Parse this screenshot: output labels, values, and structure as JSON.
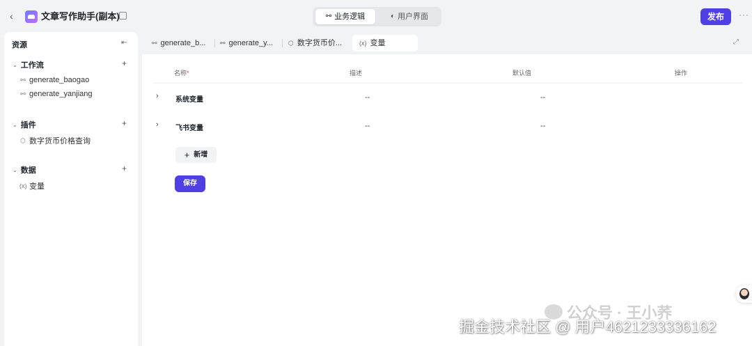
{
  "header": {
    "back_icon": "chevron-left-icon",
    "title": "文章写作助手(副本)",
    "mode_tabs": [
      {
        "label": "业务逻辑",
        "icon": "workflow-icon",
        "active": true
      },
      {
        "label": "用户界面",
        "icon": "palette-icon",
        "active": false
      }
    ],
    "publish_label": "发布",
    "more_label": "···"
  },
  "sidebar": {
    "title": "资源",
    "groups": [
      {
        "label": "工作流",
        "items": [
          {
            "label": "generate_baogao",
            "icon": "workflow-icon"
          },
          {
            "label": "generate_yanjiang",
            "icon": "workflow-icon"
          }
        ]
      },
      {
        "label": "插件",
        "items": [
          {
            "label": "数字货币价格查询",
            "icon": "plugin-icon"
          }
        ]
      },
      {
        "label": "数据",
        "items": [
          {
            "label": "变量",
            "icon": "variable-icon"
          }
        ]
      }
    ]
  },
  "tabs": [
    {
      "label": "generate_b...",
      "icon": "workflow-icon",
      "active": false
    },
    {
      "label": "generate_y...",
      "icon": "workflow-icon",
      "active": false
    },
    {
      "label": "数字货币价...",
      "icon": "plugin-icon",
      "active": false
    },
    {
      "label": "变量",
      "icon": "variable-icon",
      "active": true
    }
  ],
  "table": {
    "columns": [
      "名称",
      "描述",
      "默认值",
      "操作"
    ],
    "required_mark": "*",
    "rows": [
      {
        "name": "系统变量",
        "description": "--",
        "default": "--"
      },
      {
        "name": "飞书变量",
        "description": "--",
        "default": "--"
      }
    ]
  },
  "actions": {
    "add_label": "新增",
    "save_label": "保存"
  },
  "watermark": {
    "line1": "公众号 · 王小荞",
    "line2": "掘金技术社区 @ 用户4621233336162"
  },
  "colors": {
    "accent": "#4e40e5",
    "background": "#f2f3f5",
    "panel": "#ffffff"
  }
}
